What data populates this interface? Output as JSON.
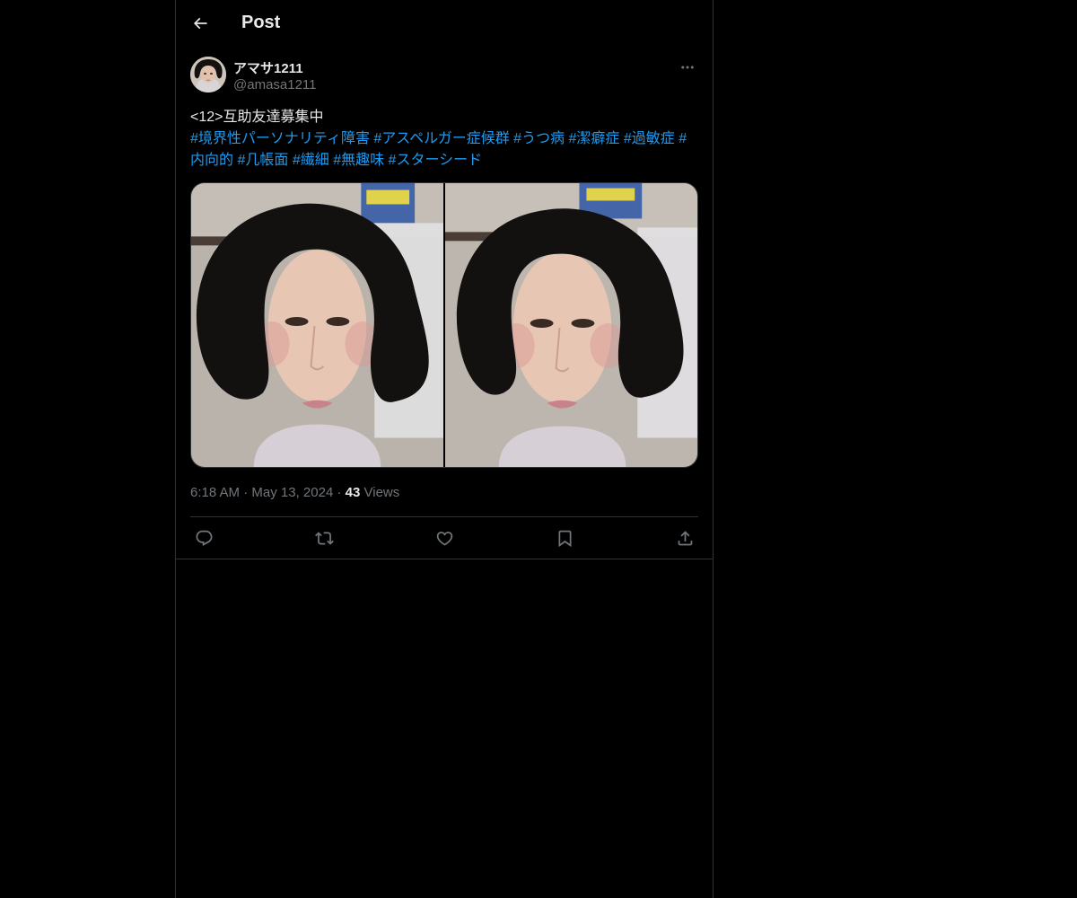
{
  "header": {
    "title": "Post"
  },
  "post": {
    "author": {
      "display_name": "アマサ1211",
      "handle": "@amasa1211"
    },
    "text_prefix": "<12>互助友達募集中",
    "hashtags": [
      "#境界性パーソナリティ障害",
      "#アスペルガー症候群",
      "#うつ病",
      "#潔癖症",
      "#過敏症",
      "#内向的",
      "#几帳面",
      "#繊細",
      "#無趣味",
      "#スターシード"
    ],
    "time": "6:18 AM",
    "separator": "·",
    "date": "May 13, 2024",
    "views_count": "43",
    "views_label": "Views"
  },
  "icons": {
    "back": "arrow-left-icon",
    "more": "more-horizontal-icon",
    "reply": "reply-icon",
    "repost": "repost-icon",
    "like": "heart-icon",
    "bookmark": "bookmark-icon",
    "share": "share-icon"
  },
  "colors": {
    "background": "#000000",
    "text": "#e7e9ea",
    "secondary": "#71767b",
    "link": "#1d9bf0",
    "border": "#2f3336"
  }
}
